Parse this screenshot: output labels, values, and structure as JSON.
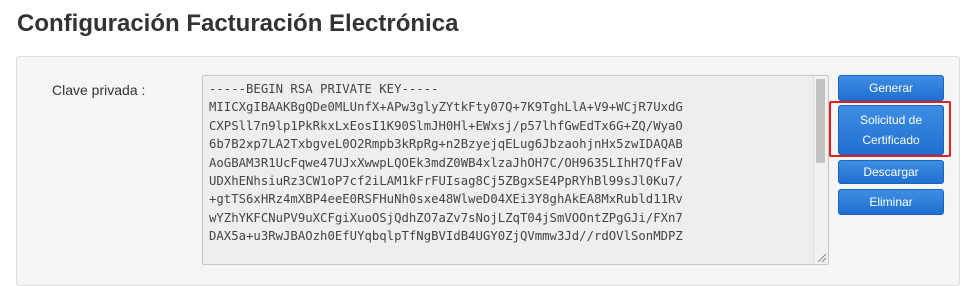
{
  "page": {
    "title": "Configuración Facturación Electrónica"
  },
  "form": {
    "private_key_label": "Clave privada :",
    "private_key_value": "-----BEGIN RSA PRIVATE KEY-----\nMIICXgIBAAKBgQDe0MLUnfX+APw3glyZYtkFty07Q+7K9TghLlA+V9+WCjR7UxdG\nCXPSll7n9lp1PkRkxLxEosI1K90SlmJH0Hl+EWxsj/p57lhfGwEdTx6G+ZQ/WyaO\n6b7B2xp7LA2TxbgveL0O2Rmpb3kRpRg+n2BzyejqELug6JbzaohjnHx5zwIDAQAB\nAoGBAM3R1UcFqwe47UJxXwwpLQOEk3mdZ0WB4xlzaJhOH7C/OH9635LIhH7QfFaV\nUDXhENhsiuRz3CW1oP7cf2iLAM1kFrFUIsag8Cj5ZBgxSE4PpRYhBl99sJl0Ku7/\n+gtTS6xHRz4mXBP4eeE0RSFHuNh0sxe48WlweD04XEi3Y8ghAkEA8MxRubld11Rv\nwYZhYKFCNuPV9uXCFgiXuoOSjQdhZO7aZv7sNojLZqT04jSmVOOntZPgGJi/FXn7\nDAX5a+u3RwJBAOzh0EfUYqbqlpTfNgBVIdB4UGY0ZjQVmmw3Jd//rdOVlSonMDPZ"
  },
  "actions": {
    "generar": "Generar",
    "solicitud": "Solicitud de Certificado",
    "descargar": "Descargar",
    "eliminar": "Eliminar"
  },
  "colors": {
    "button_primary": "#2a7ad8",
    "highlight_border": "#e02020",
    "panel_background": "#f5f5f5",
    "textarea_background": "#eeeeee"
  },
  "icons": {
    "resize": "resize-grip-icon"
  }
}
